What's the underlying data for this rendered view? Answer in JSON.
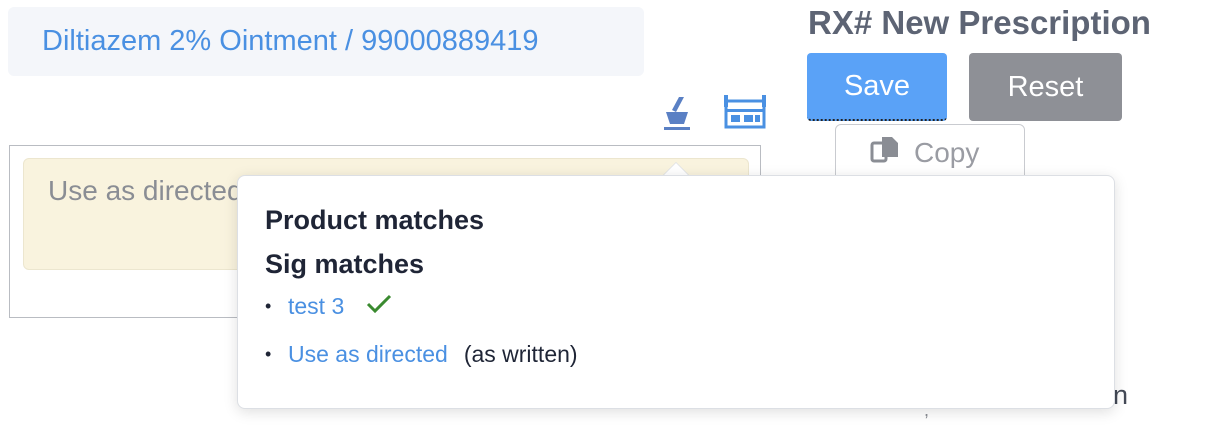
{
  "product": {
    "label": "Diltiazem 2% Ointment / 99000889419"
  },
  "header": {
    "title": "RX# New Prescription"
  },
  "toolbar": {
    "save_label": "Save",
    "reset_label": "Reset",
    "copy_label": "Copy"
  },
  "sig": {
    "value": "Use as directed"
  },
  "background_text": {
    "trailing": "on",
    "comma": ","
  },
  "popover": {
    "product_heading": "Product matches",
    "sig_heading": "Sig matches",
    "matches": [
      {
        "label": "test 3",
        "status_icon": "check-icon"
      },
      {
        "label": "Use as directed",
        "note": "(as written)"
      }
    ]
  },
  "icons": {
    "left_tool": "mortar-pestle-icon",
    "right_tool": "pill-organizer-icon"
  },
  "colors": {
    "accent": "#4a90e2",
    "save": "#5aa2f7",
    "reset": "#8e9096",
    "check": "#3a8a2f"
  }
}
